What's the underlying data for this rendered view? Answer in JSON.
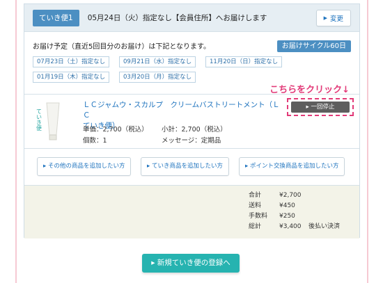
{
  "header": {
    "tag": "ていき便1",
    "delivery_text": "05月24日（火）指定なし【会員住所】へお届けします",
    "change_button": "変更"
  },
  "schedule": {
    "intro": "お届け予定（直近5回目分のお届け）は下記となります。",
    "cycle_badge": "お届けサイクル60日",
    "dates": [
      "07月23日（土）指定なし",
      "09月21日（水）指定なし",
      "11月20日（日）指定なし",
      "01月19日（木）指定なし",
      "03月20日（月）指定なし"
    ]
  },
  "annotation": "こちらをクリック↓",
  "product": {
    "image_text": "ていき便",
    "name_line1": "ＬＣジャムウ・スカルプ　クリームバストリートメント（ＬＣ",
    "name_line2": "ていき便）",
    "unit_price": "単価：2,700（税込）",
    "quantity": "個数：1",
    "subtotal": "小計：2,700（税込）",
    "message": "メッセージ：定期品",
    "pause_button": "一回停止"
  },
  "add_buttons": [
    "その他の商品を追加したい方",
    "ていき商品を追加したい方",
    "ポイント交換商品を追加したい方"
  ],
  "totals": {
    "rows": [
      {
        "label": "合計",
        "value": "¥2,700",
        "note": ""
      },
      {
        "label": "送料",
        "value": "¥450",
        "note": ""
      },
      {
        "label": "手数料",
        "value": "¥250",
        "note": ""
      },
      {
        "label": "総計",
        "value": "¥3,400",
        "note": "後払い決済"
      }
    ]
  },
  "register_button": "新規ていき便の登録へ",
  "colors": {
    "accent_blue": "#4c8fc2",
    "link_blue": "#1e73be",
    "pink_highlight": "#e23a78",
    "teal_button": "#26b3b0"
  }
}
